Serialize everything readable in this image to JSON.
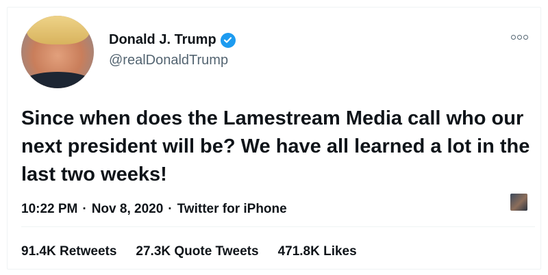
{
  "tweet": {
    "author": {
      "display_name": "Donald J. Trump",
      "handle": "@realDonaldTrump",
      "verified": true
    },
    "text": "Since when does the Lamestream Media call who our next president will be? We have all learned a lot in the last two weeks!",
    "time": "10:22 PM",
    "separator": "·",
    "date": "Nov 8, 2020",
    "source": "Twitter for iPhone",
    "stats": {
      "retweets": "91.4K Retweets",
      "quote_tweets": "27.3K Quote Tweets",
      "likes": "471.8K Likes"
    }
  },
  "colors": {
    "text": "#0f1419",
    "secondary": "#536471",
    "verified": "#1d9bf0",
    "divider": "#eff3f4"
  },
  "icons": {
    "verified": "verified-badge-icon",
    "more": "more-options-icon"
  }
}
